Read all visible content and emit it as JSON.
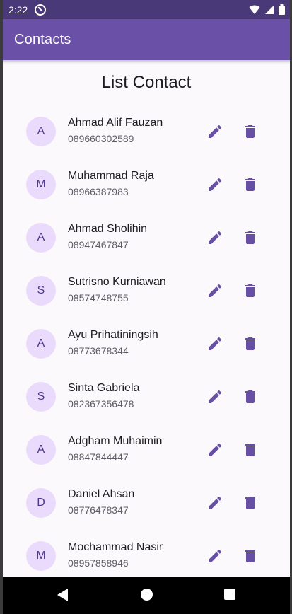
{
  "status_bar": {
    "time": "2:22"
  },
  "app_bar": {
    "title": "Contacts"
  },
  "main": {
    "heading": "List Contact",
    "contacts": [
      {
        "initial": "A",
        "name": "Ahmad Alif Fauzan",
        "phone": "089660302589"
      },
      {
        "initial": "M",
        "name": "Muhammad Raja",
        "phone": "08966387983"
      },
      {
        "initial": "A",
        "name": "Ahmad Sholihin",
        "phone": "08947467847"
      },
      {
        "initial": "S",
        "name": "Sutrisno Kurniawan",
        "phone": "08574748755"
      },
      {
        "initial": "A",
        "name": "Ayu Prihatiningsih",
        "phone": "08773678344"
      },
      {
        "initial": "S",
        "name": "Sinta Gabriela",
        "phone": "082367356478"
      },
      {
        "initial": "A",
        "name": "Adgham Muhaimin",
        "phone": "08847844447"
      },
      {
        "initial": "D",
        "name": "Daniel Ahsan",
        "phone": "08776478347"
      },
      {
        "initial": "M",
        "name": "Mochammad Nasir",
        "phone": "08957858946"
      }
    ]
  },
  "icons": {
    "edit": "pencil-icon",
    "delete": "trash-icon",
    "wifi": "wifi-icon",
    "signal": "signal-icon",
    "battery": "battery-icon"
  },
  "colors": {
    "status_bar": "#4a3978",
    "app_bar": "#6b50a8",
    "avatar_bg": "#eadbfd",
    "icon": "#6750a4",
    "background": "#fbf9fc"
  }
}
